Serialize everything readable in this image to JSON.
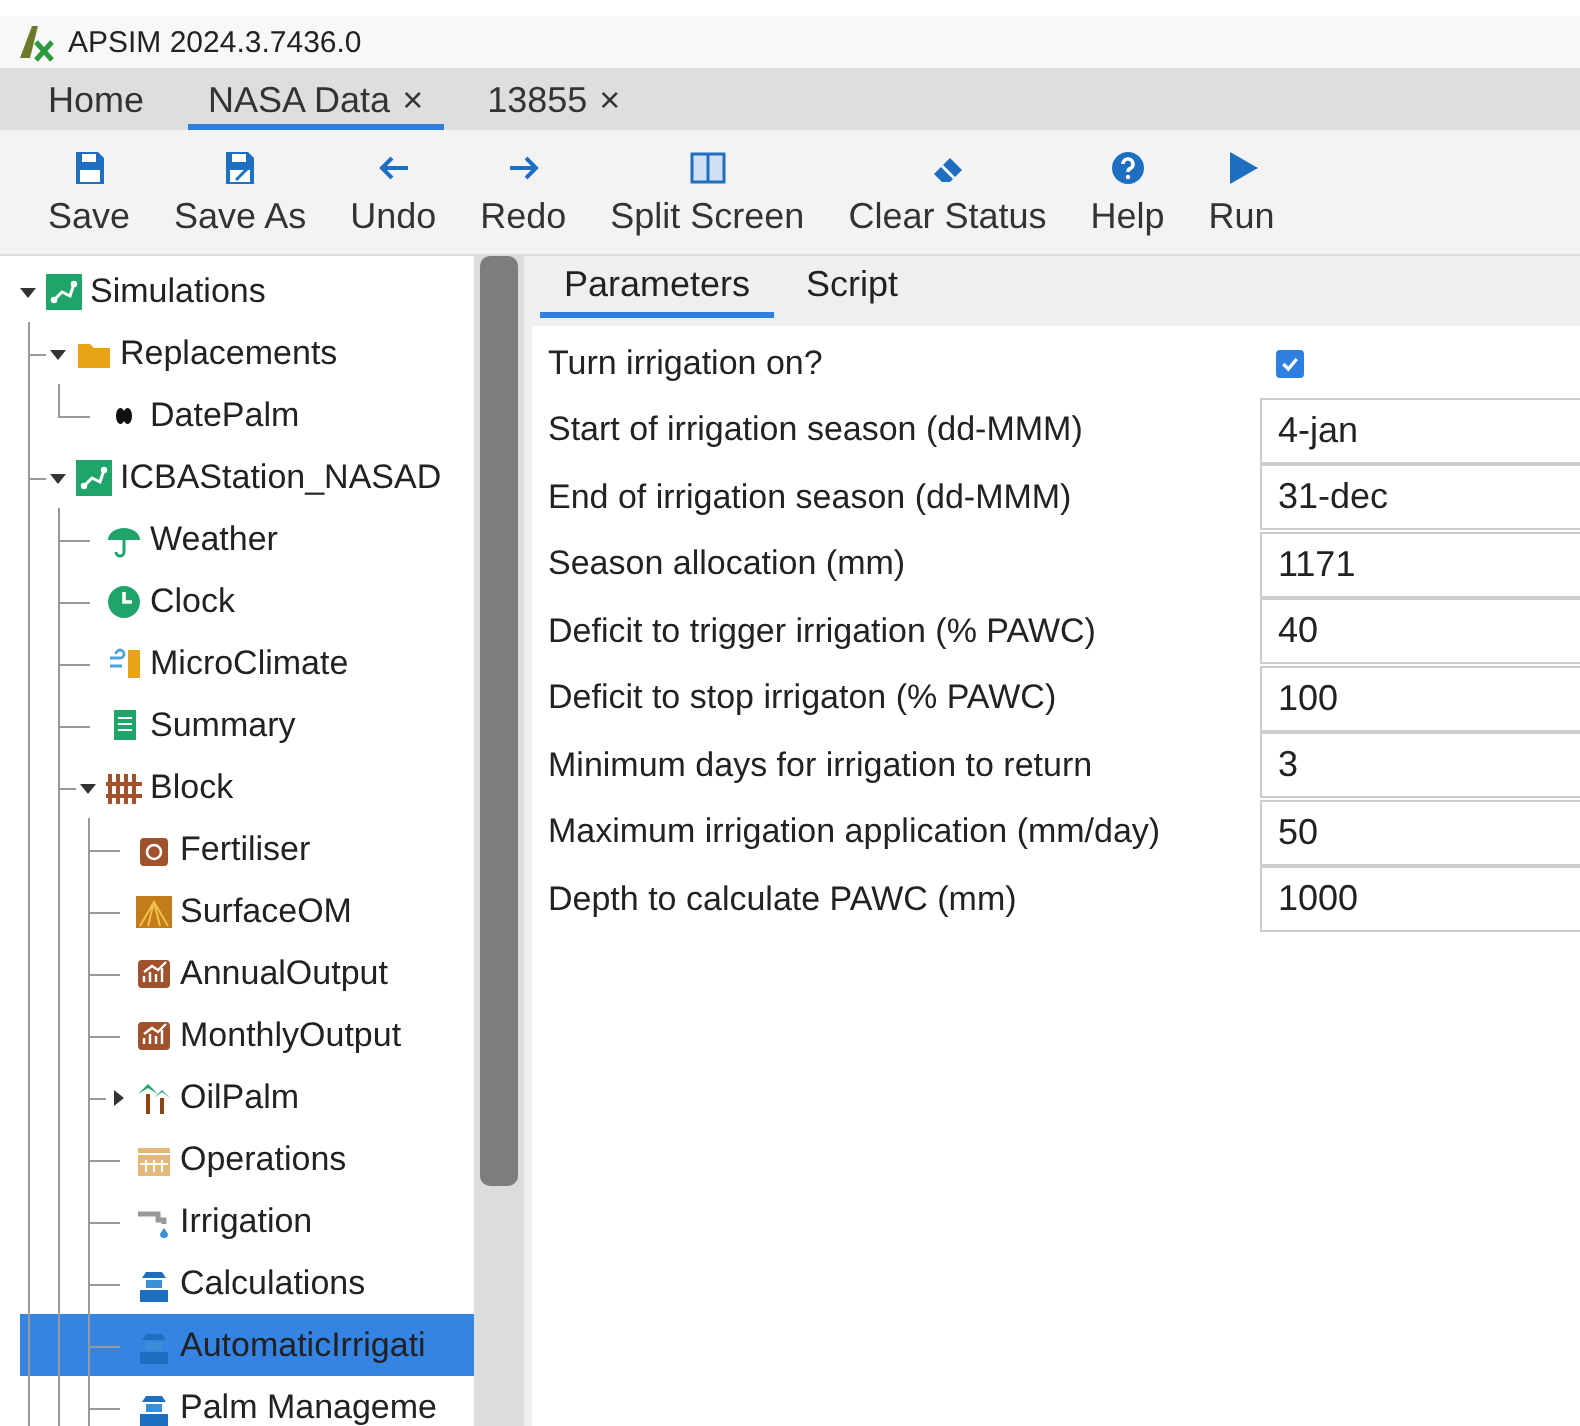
{
  "window": {
    "title": "APSIM 2024.3.7436.0"
  },
  "tabs": [
    {
      "label": "Home",
      "selected": false
    },
    {
      "label": "NASA Data",
      "close": "×",
      "selected": true
    },
    {
      "label": "13855",
      "close": "×",
      "selected": false
    }
  ],
  "toolbar": [
    {
      "kind": "save",
      "label": "Save"
    },
    {
      "kind": "save_as",
      "label": "Save As"
    },
    {
      "kind": "undo",
      "label": "Undo"
    },
    {
      "kind": "redo",
      "label": "Redo"
    },
    {
      "kind": "split",
      "label": "Split Screen"
    },
    {
      "kind": "clear",
      "label": "Clear Status"
    },
    {
      "kind": "help",
      "label": "Help"
    },
    {
      "kind": "run",
      "label": "Run"
    }
  ],
  "tree": [
    {
      "label": "Simulations",
      "kind": "simulations",
      "expanded": true,
      "selected": false,
      "children": [
        {
          "label": "Replacements",
          "kind": "folder",
          "expanded": true,
          "selected": false,
          "children": [
            {
              "label": "DatePalm",
              "kind": "cultivar",
              "selected": false
            }
          ]
        },
        {
          "label": "ICBAStation_NASAD",
          "kind": "simulation",
          "expanded": true,
          "selected": false,
          "children": [
            {
              "label": "Weather",
              "kind": "weather",
              "selected": false
            },
            {
              "label": "Clock",
              "kind": "clock",
              "selected": false
            },
            {
              "label": "MicroClimate",
              "kind": "microclimate",
              "selected": false
            },
            {
              "label": "Summary",
              "kind": "summary",
              "selected": false
            },
            {
              "label": "Block",
              "kind": "zone",
              "expanded": true,
              "selected": false,
              "children": [
                {
                  "label": "Fertiliser",
                  "kind": "fertiliser",
                  "selected": false
                },
                {
                  "label": "SurfaceOM",
                  "kind": "surfaceom",
                  "selected": false
                },
                {
                  "label": "AnnualOutput",
                  "kind": "report",
                  "selected": false
                },
                {
                  "label": "MonthlyOutput",
                  "kind": "report",
                  "selected": false
                },
                {
                  "label": "OilPalm",
                  "kind": "plant",
                  "expanded": false,
                  "selected": false
                },
                {
                  "label": "Operations",
                  "kind": "operations",
                  "selected": false
                },
                {
                  "label": "Irrigation",
                  "kind": "irrigation",
                  "selected": false
                },
                {
                  "label": "Calculations",
                  "kind": "manager",
                  "selected": false
                },
                {
                  "label": "AutomaticIrrigati",
                  "kind": "manager",
                  "selected": true
                },
                {
                  "label": "Palm Manageme",
                  "kind": "manager",
                  "selected": false
                }
              ]
            }
          ]
        }
      ]
    }
  ],
  "editor_tabs": [
    {
      "label": "Parameters",
      "selected": true
    },
    {
      "label": "Script",
      "selected": false
    }
  ],
  "properties": [
    {
      "kind": "checkbox",
      "label": "Turn irrigation on?",
      "checked": true
    },
    {
      "kind": "text",
      "label": "Start of irrigation season (dd-MMM)",
      "value": "4-jan"
    },
    {
      "kind": "text",
      "label": "End of irrigation season (dd-MMM)",
      "value": "31-dec"
    },
    {
      "kind": "text",
      "label": "Season allocation (mm)",
      "value": "1171"
    },
    {
      "kind": "text",
      "label": "Deficit to trigger irrigation (% PAWC)",
      "value": "40"
    },
    {
      "kind": "text",
      "label": "Deficit to stop irrigaton (% PAWC)",
      "value": "100"
    },
    {
      "kind": "text",
      "label": "Minimum days for irrigation to return",
      "value": "3"
    },
    {
      "kind": "text",
      "label": "Maximum irrigation application (mm/day)",
      "value": "50"
    },
    {
      "kind": "text",
      "label": "Depth to calculate PAWC (mm)",
      "value": "1000"
    }
  ]
}
